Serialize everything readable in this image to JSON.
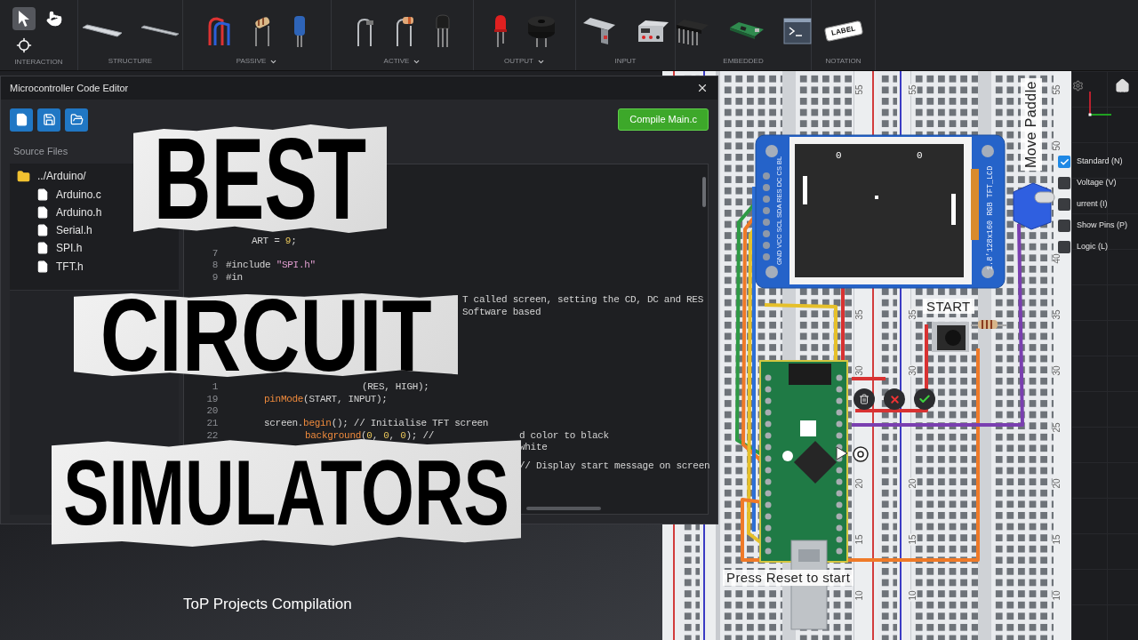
{
  "toolbar": {
    "groups": [
      {
        "label": "INTERACTION",
        "dropdown": false,
        "kind": "grid",
        "tools": [
          {
            "kind": "cursor",
            "selected": true
          },
          {
            "kind": "hand",
            "selected": false
          },
          {
            "kind": "crosshair",
            "selected": false
          }
        ]
      },
      {
        "label": "STRUCTURE",
        "dropdown": false,
        "kind": "row",
        "tools": [
          {
            "kind": "strip-long",
            "selected": false
          },
          {
            "kind": "strip-short",
            "selected": false
          }
        ]
      },
      {
        "label": "PASSIVE",
        "dropdown": true,
        "kind": "row",
        "tools": [
          {
            "kind": "jumper",
            "selected": false
          },
          {
            "kind": "resistor",
            "selected": false
          },
          {
            "kind": "capacitor",
            "selected": false
          }
        ]
      },
      {
        "label": "ACTIVE",
        "dropdown": true,
        "kind": "row",
        "tools": [
          {
            "kind": "diode",
            "selected": false
          },
          {
            "kind": "banded-diode",
            "selected": false
          },
          {
            "kind": "transistor",
            "selected": false
          }
        ]
      },
      {
        "label": "OUTPUT",
        "dropdown": true,
        "kind": "row",
        "tools": [
          {
            "kind": "led",
            "selected": false
          },
          {
            "kind": "buzzer",
            "selected": false
          }
        ]
      },
      {
        "label": "INPUT",
        "dropdown": false,
        "kind": "row",
        "tools": [
          {
            "kind": "switch",
            "selected": false
          },
          {
            "kind": "power-supply",
            "selected": false
          }
        ]
      },
      {
        "label": "EMBEDDED",
        "dropdown": false,
        "kind": "row",
        "tools": [
          {
            "kind": "chip",
            "selected": false
          },
          {
            "kind": "board",
            "selected": false
          },
          {
            "kind": "terminal",
            "selected": false
          }
        ]
      },
      {
        "label": "NOTATION",
        "dropdown": false,
        "kind": "row",
        "tools": [
          {
            "kind": "label",
            "text": "LABEL",
            "selected": false
          }
        ]
      }
    ]
  },
  "editor": {
    "title": "Microcontroller Code Editor",
    "compile_button": "Compile Main.c",
    "source_files": {
      "label": "Source Files",
      "tree": [
        {
          "name": "../Arduino/",
          "kind": "folder",
          "children": [
            {
              "name": "Arduino.c",
              "kind": "file"
            },
            {
              "name": "Arduino.h",
              "kind": "file"
            },
            {
              "name": "Serial.h",
              "kind": "file"
            },
            {
              "name": "SPI.h",
              "kind": "file"
            },
            {
              "name": "TFT.h",
              "kind": "file"
            }
          ]
        }
      ]
    },
    "code": {
      "blocks": [
        {
          "lines": [
            {
              "segments": [
                {
                  "kind": "after-cover",
                  "tokens": [
                    {
                      "text": "ART = ",
                      "kind": "plain"
                    },
                    {
                      "text": "9",
                      "kind": "number"
                    },
                    {
                      "text": ";",
                      "kind": "plain"
                    }
                  ]
                }
              ]
            },
            {
              "number": "7"
            },
            {
              "number": "8",
              "segments": [
                {
                  "kind": "code",
                  "tokens": [
                    {
                      "text": "#include ",
                      "kind": "plain"
                    },
                    {
                      "text": "\"SPI.h\"",
                      "kind": "string"
                    }
                  ]
                }
              ]
            },
            {
              "number": "9",
              "segments": [
                {
                  "kind": "code",
                  "tokens": [
                    {
                      "text": "#in",
                      "kind": "plain"
                    }
                  ]
                }
              ]
            }
          ]
        },
        {
          "lines": [
            {
              "segments": [
                {
                  "kind": "tail-a",
                  "tokens": [
                    {
                      "text": "T called screen, setting the CD, DC and RES",
                      "kind": "plain"
                    }
                  ]
                }
              ]
            },
            {
              "segments": [
                {
                  "kind": "tail-a",
                  "tokens": [
                    {
                      "text": "Software based",
                      "kind": "plain"
                    }
                  ]
                }
              ]
            }
          ]
        },
        {
          "lines": [
            {
              "number": "1",
              "segments": [
                {
                  "kind": "mid",
                  "tokens": [
                    {
                      "text": "(RES, HIGH);",
                      "kind": "plain"
                    }
                  ]
                }
              ]
            },
            {
              "number": "19",
              "segments": [
                {
                  "kind": "indent",
                  "tokens": [
                    {
                      "text": "pinMode",
                      "kind": "function"
                    },
                    {
                      "text": "(START, INPUT);",
                      "kind": "plain"
                    }
                  ]
                }
              ]
            },
            {
              "number": "20"
            },
            {
              "number": "21",
              "segments": [
                {
                  "kind": "indent",
                  "tokens": [
                    {
                      "text": "screen.",
                      "kind": "plain"
                    },
                    {
                      "text": "begin",
                      "kind": "function"
                    },
                    {
                      "text": "(); // Initialise TFT screen",
                      "kind": "plain"
                    }
                  ]
                }
              ]
            },
            {
              "number": "22",
              "segments": [
                {
                  "kind": "indent-cover",
                  "tokens": [
                    {
                      "text": "background",
                      "kind": "function"
                    },
                    {
                      "text": "(",
                      "kind": "plain"
                    },
                    {
                      "text": "0",
                      "kind": "number"
                    },
                    {
                      "text": ", ",
                      "kind": "plain"
                    },
                    {
                      "text": "0",
                      "kind": "number"
                    },
                    {
                      "text": ", ",
                      "kind": "plain"
                    },
                    {
                      "text": "0",
                      "kind": "number"
                    },
                    {
                      "text": "); //",
                      "kind": "plain"
                    }
                  ]
                },
                {
                  "kind": "tail-b",
                  "tokens": [
                    {
                      "text": "d color to black",
                      "kind": "plain"
                    }
                  ]
                }
              ]
            },
            {
              "segments": [
                {
                  "kind": "tail-b",
                  "tokens": [
                    {
                      "text": "white",
                      "kind": "plain"
                    }
                  ]
                }
              ]
            }
          ]
        },
        {
          "lines": [
            {
              "segments": [
                {
                  "kind": "tail-b",
                  "tokens": [
                    {
                      "text": "// Display start message on screen",
                      "kind": "plain"
                    }
                  ]
                }
              ]
            }
          ]
        }
      ]
    }
  },
  "headlines": [
    "BEST",
    "CIRCUIT",
    "SIMULATORS"
  ],
  "caption": "ToP Projects Compilation",
  "circuit": {
    "paddle_label": "Move Paddle",
    "start_label": "START",
    "reset_hint": "Press Reset to start",
    "lcd": {
      "pin_labels": "GND VCC SCL SDA RES DC CS BL",
      "model_label": "1.8'128x160 RGB TFT_LCD",
      "scores": [
        "0",
        "0"
      ]
    },
    "row_numbers": [
      {
        "labels": [
          "55",
          "35",
          "30",
          "20",
          "15",
          "10"
        ]
      },
      {
        "labels": [
          "55",
          "35",
          "30",
          "20",
          "15",
          "10"
        ]
      },
      {
        "labels": [
          "55",
          "50",
          "40",
          "35",
          "30",
          "25",
          "20",
          "15",
          "10"
        ]
      }
    ]
  },
  "view_modes": [
    {
      "label": "Standard (N)",
      "checked": true
    },
    {
      "label": "Voltage (V)",
      "checked": false
    },
    {
      "label": "urrent (I)",
      "checked": false
    },
    {
      "label": "Show Pins (P)",
      "checked": false
    },
    {
      "label": "Logic (L)",
      "checked": false
    }
  ]
}
